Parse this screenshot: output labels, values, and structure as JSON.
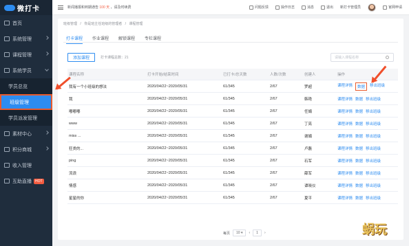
{
  "app": {
    "logo_text": "微打卡"
  },
  "sidebar": {
    "items": [
      {
        "label": "首页",
        "icon": "home-icon",
        "chevron": ""
      },
      {
        "label": "系统管理",
        "icon": "settings-icon",
        "chevron": "right"
      },
      {
        "label": "课程管理",
        "icon": "book-icon",
        "chevron": "right"
      },
      {
        "label": "系统学员",
        "icon": "user-icon",
        "chevron": "down"
      }
    ],
    "subitems": [
      {
        "label": "学员总览",
        "state": "normal"
      },
      {
        "label": "班级管理",
        "state": "active"
      },
      {
        "label": "学员派发管理",
        "state": "normal"
      }
    ],
    "items2": [
      {
        "label": "素材中心",
        "icon": "folder-icon",
        "chevron": "right"
      },
      {
        "label": "积分商城",
        "icon": "shop-icon",
        "chevron": "right"
      },
      {
        "label": "收入管理",
        "icon": "money-icon",
        "chevron": ""
      },
      {
        "label": "互助直播",
        "icon": "live-icon",
        "chevron": "",
        "badge": "HOT"
      }
    ]
  },
  "topbar": {
    "notice_prefix": "新闻播报和到期通告",
    "notice_highlight": "100 天",
    "notice_suffix": "，请及时续费",
    "actions": [
      "问题反馈",
      "操作日志",
      "消息",
      "退出"
    ],
    "account": "新打卡管理员",
    "manage_label": "官网申请"
  },
  "page": {
    "breadcrumb": [
      "班级管理",
      "/",
      "你是班主任班级的管理者",
      "/",
      "课程管理"
    ],
    "tabs": [
      "打卡课程",
      "作业课程",
      "解锁课程",
      "专栏课程"
    ],
    "add_button": "添加课程",
    "total": "打卡课程总数：21",
    "search_placeholder": "请输入课程名称"
  },
  "table": {
    "headers": [
      "课程名称",
      "打卡开始/结束时间",
      "已打卡/总天数",
      "人数/次数",
      "创建人",
      "操作"
    ],
    "rows": [
      {
        "name": "我有一个小班级的想法",
        "time": "2020/04/22~2020/05/31",
        "days": "61/345",
        "people": "2/67",
        "creator": "罗超"
      },
      {
        "name": "我",
        "time": "2020/04/22~2020/05/31",
        "days": "61/345",
        "people": "2/67",
        "creator": "韩艳"
      },
      {
        "name": "嘟嘟嘟",
        "time": "2020/04/22~2020/05/31",
        "days": "61/345",
        "people": "2/67",
        "creator": "任娟"
      },
      {
        "name": "www",
        "time": "2020/04/22~2020/05/31",
        "days": "61/345",
        "people": "2/67",
        "creator": "丁亮"
      },
      {
        "name": "miss ...",
        "time": "2020/04/22~2020/05/31",
        "days": "61/345",
        "people": "2/67",
        "creator": "谢娟"
      },
      {
        "name": "狂类的...",
        "time": "2020/04/22~2020/05/31",
        "days": "61/345",
        "people": "2/67",
        "creator": "卢磊"
      },
      {
        "name": "ping",
        "time": "2020/04/22~2020/05/31",
        "days": "61/345",
        "people": "2/67",
        "creator": "石军"
      },
      {
        "name": "流浪",
        "time": "2020/04/22~2020/05/31",
        "days": "61/345",
        "people": "2/67",
        "creator": "薛军"
      },
      {
        "name": "情感",
        "time": "2020/04/22~2020/05/31",
        "days": "61/345",
        "people": "2/67",
        "creator": "谭晓仪"
      },
      {
        "name": "星星的你",
        "time": "2020/04/22~2020/05/31",
        "days": "61/345",
        "people": "2/67",
        "creator": "夏平"
      }
    ],
    "ops": [
      "课程详情",
      "数据",
      "移出班级"
    ]
  },
  "pager": {
    "label": "每页",
    "size": "10",
    "prev": "‹",
    "page": "1",
    "next": "›"
  },
  "watermark": "蜗玩",
  "colors": {
    "primary": "#2d8cf0",
    "annotation": "#f04f2b",
    "sidebar_bg": "#1f2d3d"
  }
}
